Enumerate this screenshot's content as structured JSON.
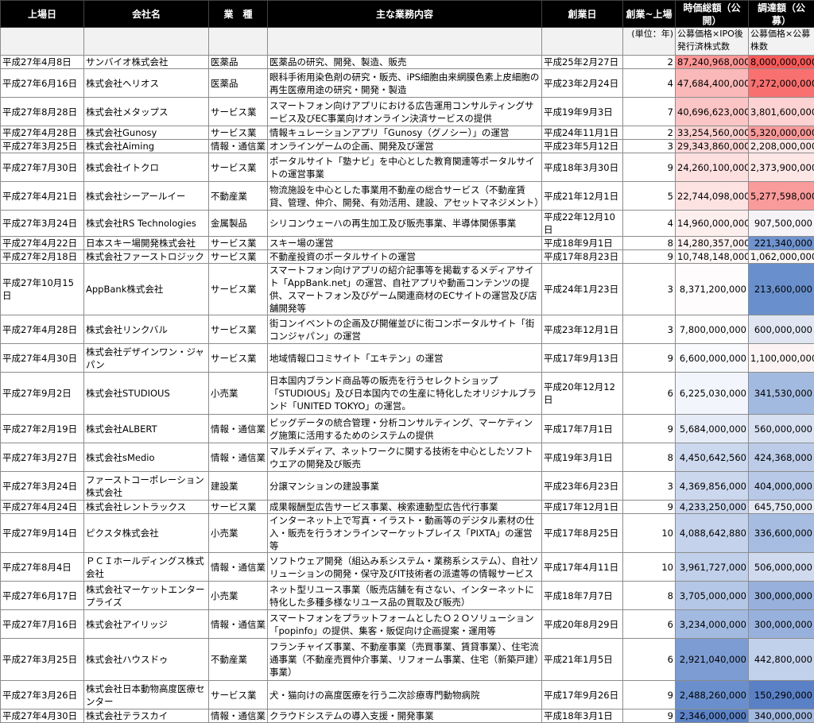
{
  "headers": [
    "上場日",
    "会社名",
    "業　種",
    "主な業務内容",
    "創業日",
    "創業~上場",
    "時価総額（公開）",
    "調達額（公募）"
  ],
  "subheader": {
    "years_unit": "(単位：年)",
    "market_cap_note": "公募価格×IPO後発行済株式数",
    "raised_note": "公募価格×公募株数"
  },
  "rows": [
    {
      "date": "平成27年4月8日",
      "company": "サンバイオ株式会社",
      "industry": "医薬品",
      "business": "医薬品の研究、開発、製造、販売",
      "founded": "平成25年2月27日",
      "years": "2",
      "market_cap": "87,240,968,000",
      "raised": "8,000,000,000",
      "cap_bg": "#ff9595",
      "raised_bg": "#f85a5a",
      "h": 17
    },
    {
      "date": "平成27年6月16日",
      "company": "株式会社ヘリオス",
      "industry": "医薬品",
      "business": "眼科手術用染色剤の研究・販売、iPS細胞由来網膜色素上皮細胞の再生医療用途の研究・開発・製造",
      "founded": "平成23年2月24日",
      "years": "4",
      "market_cap": "47,684,400,000",
      "raised": "7,272,000,000",
      "cap_bg": "#fbb8b8",
      "raised_bg": "#f97070",
      "h": 36
    },
    {
      "date": "平成27年8月28日",
      "company": "株式会社メタップス",
      "industry": "サービス業",
      "business": "スマートフォン向けアプリにおける広告運用コンサルティングサービス及びEC事業向けオンライン決済サービスの提供",
      "founded": "平成19年9月3日",
      "years": "7",
      "market_cap": "40,696,623,000",
      "raised": "3,801,600,000",
      "cap_bg": "#fcc5c5",
      "raised_bg": "#fcd2d2",
      "h": 36
    },
    {
      "date": "平成27年4月28日",
      "company": "株式会社Gunosy",
      "industry": "サービス業",
      "business": "情報キュレーションアプリ「Gunosy（グノシー）」の運営",
      "founded": "平成24年11月1日",
      "years": "2",
      "market_cap": "33,254,560,000",
      "raised": "5,320,000,000",
      "cap_bg": "#fccfcf",
      "raised_bg": "#fa9a9a",
      "h": 17
    },
    {
      "date": "平成27年3月25日",
      "company": "株式会社Aiming",
      "industry": "情報・通信業",
      "business": "オンラインゲームの企画、開発及び運営",
      "founded": "平成23年5月12日",
      "years": "3",
      "market_cap": "29,343,860,000",
      "raised": "2,208,000,000",
      "cap_bg": "#fcd6d6",
      "raised_bg": "#fde8e8",
      "h": 17
    },
    {
      "date": "平成27年7月30日",
      "company": "株式会社イトクロ",
      "industry": "サービス業",
      "business": "ポータルサイト「塾ナビ」を中心とした教育関連等ポータルサイトの運営事業",
      "founded": "平成18年3月30日",
      "years": "9",
      "market_cap": "24,260,100,000",
      "raised": "2,373,900,000",
      "cap_bg": "#fddfdf",
      "raised_bg": "#fde6e6",
      "h": 36
    },
    {
      "date": "平成27年4月21日",
      "company": "株式会社シーアールイー",
      "industry": "不動産業",
      "business": "物流施設を中心とした事業用不動産の総合サービス（不動産賃貸、管理、仲介、開発、有効活用、建設、アセットマネジメント）",
      "founded": "平成21年12月1日",
      "years": "5",
      "market_cap": "22,744,098,000",
      "raised": "5,277,598,000",
      "cap_bg": "#fde2e2",
      "raised_bg": "#fa9b9b",
      "h": 36
    },
    {
      "date": "平成27年3月24日",
      "company": "株式会社RS Technologies",
      "industry": "金属製品",
      "business": "シリコンウェーハの再生加工及び販売事業、半導体関係事業",
      "founded": "平成22年12月10日",
      "years": "4",
      "market_cap": "14,960,000,000",
      "raised": "907,500,000",
      "cap_bg": "#feefef",
      "raised_bg": "#f6f3f6",
      "h": 17
    },
    {
      "date": "平成27年4月22日",
      "company": "日本スキー場開発株式会社",
      "industry": "サービス業",
      "business": "スキー場の運営",
      "founded": "平成18年9月1日",
      "years": "8",
      "market_cap": "14,280,357,000",
      "raised": "221,340,000",
      "cap_bg": "#fef1f1",
      "raised_bg": "#6e93cf",
      "h": 17
    },
    {
      "date": "平成27年2月18日",
      "company": "株式会社ファーストロジック",
      "industry": "サービス業",
      "business": "不動産投資のポータルサイトの運営",
      "founded": "平成17年8月23日",
      "years": "9",
      "market_cap": "10,748,148,000",
      "raised": "1,062,000,000",
      "cap_bg": "#fef8f8",
      "raised_bg": "#fcf6f6",
      "h": 17
    },
    {
      "date": "平成27年10月15日",
      "company": "AppBank株式会社",
      "industry": "サービス業",
      "business": "スマートフォン向けアプリの紹介記事等を掲載するメディアサイト「AppBank.net」の運営、自社アプリや動画コンテンツの提供、スマートフォン及びゲーム関連商材のECサイトの運営及び店舗開発等",
      "founded": "平成24年1月23日",
      "years": "3",
      "market_cap": "8,371,200,000",
      "raised": "213,600,000",
      "cap_bg": "#fefcfc",
      "raised_bg": "#6990cd",
      "h": 53
    },
    {
      "date": "平成27年4月28日",
      "company": "株式会社リンクバル",
      "industry": "サービス業",
      "business": "街コンイベントの企画及び開催並びに街コンポータルサイト「街コンジャパン」の運営",
      "founded": "平成23年12月1日",
      "years": "3",
      "market_cap": "7,800,000,000",
      "raised": "600,000,000",
      "cap_bg": "#fefefe",
      "raised_bg": "#dfe6f2",
      "h": 36
    },
    {
      "date": "平成27年4月30日",
      "company": "株式会社デザインワン・ジャパン",
      "industry": "サービス業",
      "business": "地域情報口コミサイト「エキテン」の運営",
      "founded": "平成17年9月13日",
      "years": "9",
      "market_cap": "6,600,000,000",
      "raised": "1,100,000,000",
      "cap_bg": "#f9fafd",
      "raised_bg": "#fcf4f4",
      "h": 36
    },
    {
      "date": "平成27年9月2日",
      "company": "株式会社STUDIOUS",
      "industry": "小売業",
      "business": "日本国内ブランド商品等の販売を行うセレクトショップ「STUDIOUS」及び日本国内での生産に特化したオリジナルブランド「UNITED TOKYO」の運営。",
      "founded": "平成20年12月12日",
      "years": "6",
      "market_cap": "6,225,030,000",
      "raised": "341,530,000",
      "cap_bg": "#f2f5fb",
      "raised_bg": "#a3bae0",
      "h": 53
    },
    {
      "date": "平成27年2月19日",
      "company": "株式会社ALBERT",
      "industry": "情報・通信業",
      "business": "ビッグデータの統合管理・分析コンサルティング、マーケティング施策に活用するためのシステムの提供",
      "founded": "平成17年7月1日",
      "years": "9",
      "market_cap": "5,684,000,000",
      "raised": "560,000,000",
      "cap_bg": "#e6ecf7",
      "raised_bg": "#d7e0f0",
      "h": 36
    },
    {
      "date": "平成27年3月27日",
      "company": "株式会社sMedio",
      "industry": "情報・通信業",
      "business": "マルチメディア、ネットワークに関する技術を中心としたソフトウエアの開発及び販売",
      "founded": "平成19年3月1日",
      "years": "8",
      "market_cap": "4,450,642,560",
      "raised": "424,368,000",
      "cap_bg": "#ccd8ee",
      "raised_bg": "#bccce8",
      "h": 36
    },
    {
      "date": "平成27年3月24日",
      "company": "ファーストコーポレーション株式会社",
      "industry": "建設業",
      "business": "分譲マンションの建設事業",
      "founded": "平成23年6月23日",
      "years": "3",
      "market_cap": "4,369,856,000",
      "raised": "404,000,000",
      "cap_bg": "#cbd7ed",
      "raised_bg": "#b7c9e6",
      "h": 36
    },
    {
      "date": "平成27年4月24日",
      "company": "株式会社レントラックス",
      "industry": "サービス業",
      "business": "成果報酬型広告サービス事業、検索連動型広告代行事業",
      "founded": "平成17年12月1日",
      "years": "9",
      "market_cap": "4,233,250,000",
      "raised": "645,750,000",
      "cap_bg": "#c8d5ec",
      "raised_bg": "#e2e9f4",
      "h": 17
    },
    {
      "date": "平成27年9月14日",
      "company": "ピクスタ株式会社",
      "industry": "小売業",
      "business": "インターネット上で写真・イラスト・動画等のデジタル素材の仕入・販売を行うオンラインマーケットプレイス「PIXTA」の運営等",
      "founded": "平成17年8月25日",
      "years": "10",
      "market_cap": "4,088,642,880",
      "raised": "336,600,000",
      "cap_bg": "#c4d2eb",
      "raised_bg": "#a6bde1",
      "h": 36
    },
    {
      "date": "平成27年8月4日",
      "company": "ＰＣＩホールディングス株式会社",
      "industry": "情報・通信業",
      "business": "ソフトウェア開発（組込み系システム・業務系システム）、自社ソリューションの開発・保守及びIT技術者の派遣等の情報サービス",
      "founded": "平成17年4月11日",
      "years": "10",
      "market_cap": "3,961,727,000",
      "raised": "506,000,000",
      "cap_bg": "#c1d0ea",
      "raised_bg": "#cfdaee",
      "h": 36
    },
    {
      "date": "平成27年6月17日",
      "company": "株式会社マーケットエンタープライズ",
      "industry": "小売業",
      "business": "ネット型リユース事業（販売店舗を有さない、インターネットに特化した多種多様なリユース品の買取及び販売）",
      "founded": "平成18年7月7日",
      "years": "8",
      "market_cap": "3,705,000,000",
      "raised": "300,000,000",
      "cap_bg": "#b5c7e6",
      "raised_bg": "#97b1dc",
      "h": 36
    },
    {
      "date": "平成27年7月16日",
      "company": "株式会社アイリッジ",
      "industry": "情報・通信業",
      "business": "スマートフォンをプラットフォームとしたＯ２Ｏソリューション「popinfo」の提供、集客・販促向け企画提案・運用等",
      "founded": "平成20年8月29日",
      "years": "6",
      "market_cap": "3,234,000,000",
      "raised": "300,000,000",
      "cap_bg": "#a2b9e0",
      "raised_bg": "#97b1dc",
      "h": 36
    },
    {
      "date": "平成27年3月25日",
      "company": "株式会社ハウスドゥ",
      "industry": "不動産業",
      "business": "フランチャイズ事業、不動産事業（売買事業、賃貸事業）、住宅流通事業（不動産売買仲介事業、リフォーム事業、住宅（新築戸建）事業）",
      "founded": "平成21年1月5日",
      "years": "6",
      "market_cap": "2,921,040,000",
      "raised": "442,800,000",
      "cap_bg": "#7c9cd3",
      "raised_bg": "#c2d1eb",
      "h": 53
    },
    {
      "date": "平成27年3月26日",
      "company": "株式会社日本動物高度医療センター",
      "industry": "サービス業",
      "business": "犬・猫向けの高度医療を行う二次診療専門動物病院",
      "founded": "平成17年9月26日",
      "years": "9",
      "market_cap": "2,488,260,000",
      "raised": "150,290,000",
      "cap_bg": "#6a8fcc",
      "raised_bg": "#5a80c6",
      "h": 36
    },
    {
      "date": "平成27年4月30日",
      "company": "株式会社テラスカイ",
      "industry": "情報・通信業",
      "business": "クラウドシステムの導入支援・開発事業",
      "founded": "平成18年3月1日",
      "years": "9",
      "market_cap": "2,346,000,000",
      "raised": "340,000,000",
      "cap_bg": "#5c83c8",
      "raised_bg": "#a2b9e0",
      "h": 17
    }
  ]
}
